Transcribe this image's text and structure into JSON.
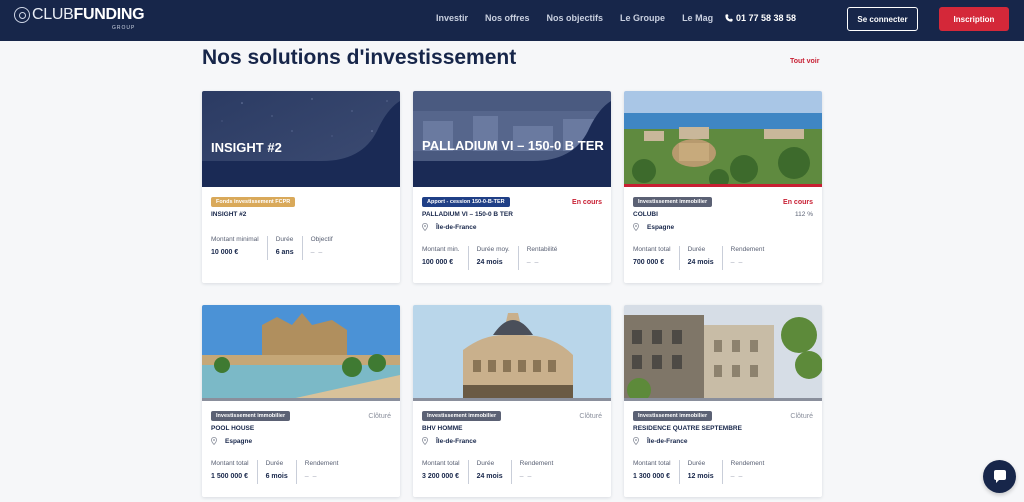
{
  "nav": {
    "logo_club": "CLUB",
    "logo_funding": "FUNDING",
    "logo_group": "GROUP",
    "menu": [
      "Investir",
      "Nos offres",
      "Nos objectifs",
      "Le Groupe",
      "Le Mag"
    ],
    "phone": "01 77 58 38 58",
    "login_label": "Se connecter",
    "signup_label": "Inscription"
  },
  "section": {
    "title": "Nos solutions d'investissement",
    "see_all": "Tout voir"
  },
  "cards": [
    {
      "overlay_title": "INSIGHT #2",
      "badge": "Fonds investissement FCPR",
      "badge_color": "#d9a95a",
      "status": "",
      "rate": "",
      "name": "INSIGHT #2",
      "location": "",
      "metrics": [
        {
          "label": "Montant minimal",
          "value": "10 000 €"
        },
        {
          "label": "Durée",
          "value": "6 ans"
        },
        {
          "label": "Objectif",
          "value": "– –"
        }
      ]
    },
    {
      "overlay_title": "PALLADIUM VI – 150-0 B TER",
      "badge": "Apport - cession 150-0-B-TER",
      "badge_color": "#1f3f86",
      "status": "En cours",
      "rate": "",
      "name": "PALLADIUM VI – 150-0 B TER",
      "location": "Île-de-France",
      "metrics": [
        {
          "label": "Montant min.",
          "value": "100 000 €"
        },
        {
          "label": "Durée moy.",
          "value": "24 mois"
        },
        {
          "label": "Rentabilité",
          "value": "– –"
        }
      ]
    },
    {
      "overlay_title": "",
      "badge": "Investissement immobilier",
      "badge_color": "#5b6174",
      "status": "En cours",
      "rate": "112 %",
      "name": "COLUBI",
      "location": "Espagne",
      "metrics": [
        {
          "label": "Montant total",
          "value": "700 000 €"
        },
        {
          "label": "Durée",
          "value": "24 mois"
        },
        {
          "label": "Rendement",
          "value": "– –"
        }
      ]
    },
    {
      "overlay_title": "",
      "badge": "Investissement immobilier",
      "badge_color": "#5b6174",
      "status": "Clôturé",
      "rate": "",
      "name": "POOL HOUSE",
      "location": "Espagne",
      "metrics": [
        {
          "label": "Montant total",
          "value": "1 500 000 €"
        },
        {
          "label": "Durée",
          "value": "6 mois"
        },
        {
          "label": "Rendement",
          "value": "– –"
        }
      ]
    },
    {
      "overlay_title": "",
      "badge": "Investissement immobilier",
      "badge_color": "#5b6174",
      "status": "Clôturé",
      "rate": "",
      "name": "BHV HOMME",
      "location": "Île-de-France",
      "metrics": [
        {
          "label": "Montant total",
          "value": "3 200 000 €"
        },
        {
          "label": "Durée",
          "value": "24 mois"
        },
        {
          "label": "Rendement",
          "value": "– –"
        }
      ]
    },
    {
      "overlay_title": "",
      "badge": "Investissement immobilier",
      "badge_color": "#5b6174",
      "status": "Clôturé",
      "rate": "",
      "name": "RESIDENCE QUATRE SEPTEMBRE",
      "location": "Île-de-France",
      "metrics": [
        {
          "label": "Montant total",
          "value": "1 300 000 €"
        },
        {
          "label": "Durée",
          "value": "12 mois"
        },
        {
          "label": "Rendement",
          "value": "– –"
        }
      ]
    }
  ]
}
